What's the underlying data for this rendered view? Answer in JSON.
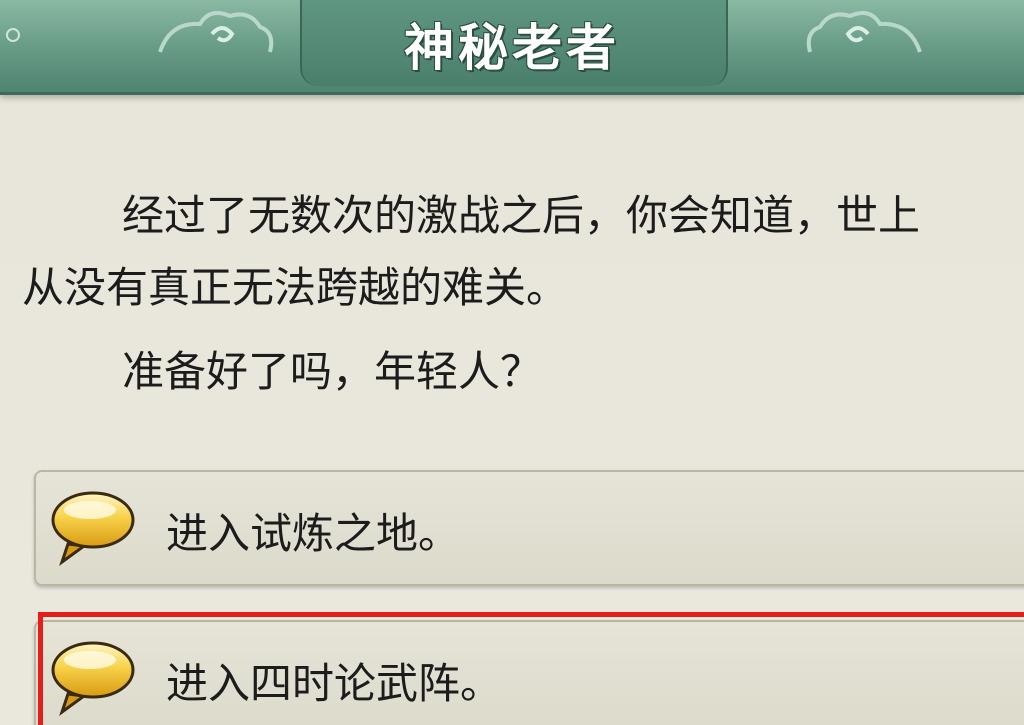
{
  "dialog": {
    "title": "神秘老者",
    "narration_line1": "经过了无数次的激战之后，你会知道，世上",
    "narration_line2": "从没有真正无法跨越的难关。",
    "question": "准备好了吗，年轻人？"
  },
  "options": [
    {
      "label": "进入试炼之地。",
      "icon": "speech-bubble-icon",
      "selected": false
    },
    {
      "label": "进入四时论武阵。",
      "icon": "speech-bubble-icon",
      "selected": true
    }
  ],
  "colors": {
    "title_bar": "#6c9f8a",
    "panel": "#eae8dd",
    "highlight": "#e51d1d",
    "bubble": "#f2c230"
  }
}
